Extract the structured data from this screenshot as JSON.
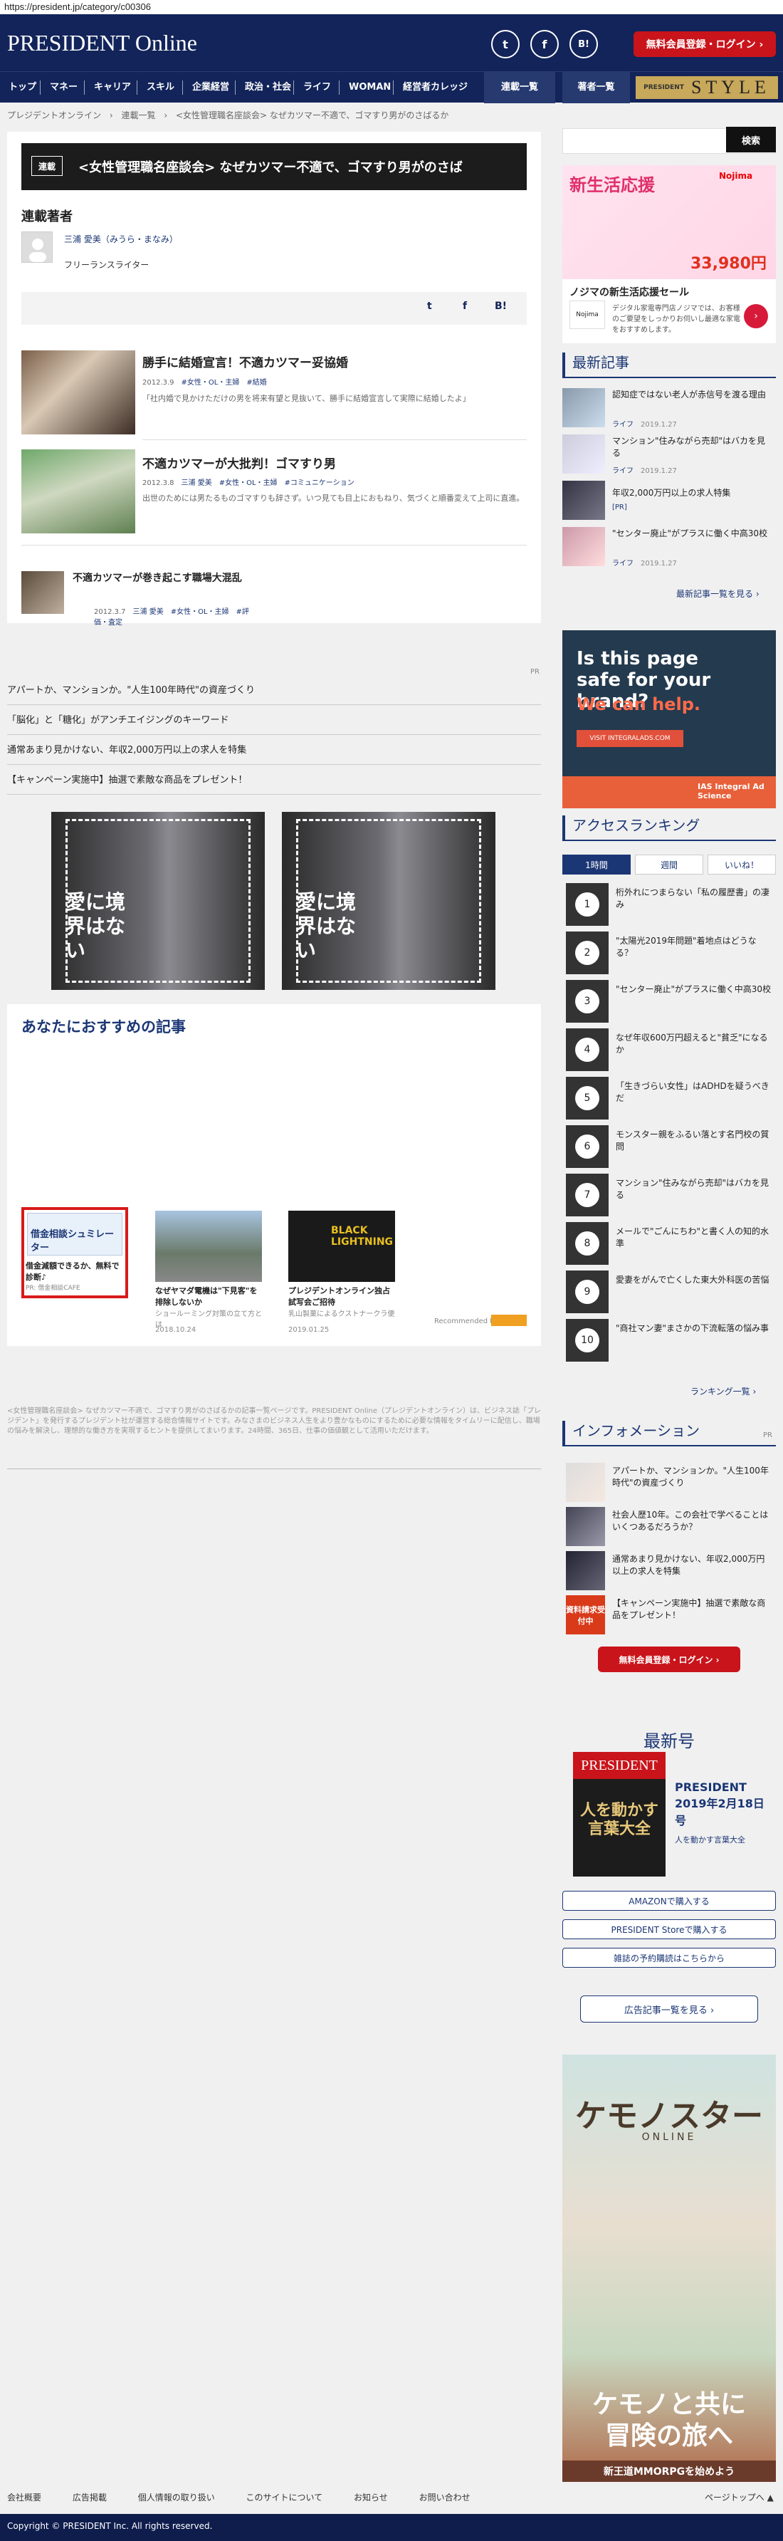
{
  "browser": {
    "url": "https://president.jp/category/c00306"
  },
  "header": {
    "logo_main": "PRESIDENT",
    "logo_sub": "Online",
    "member_button": "無料会員登録・ログイン ›",
    "sns": [
      "t",
      "f",
      "B!"
    ]
  },
  "nav": {
    "items": [
      "トップ",
      "マネー",
      "キャリア",
      "スキル",
      "企業経営",
      "政治・社会",
      "ライフ",
      "WOMAN",
      "経営者カレッジ"
    ],
    "serial_label": "連載一覧",
    "author_label": "著者一覧",
    "style_small": "PRESIDENT",
    "style_big": "STYLE"
  },
  "breadcrumb": [
    "プレジデントオンライン",
    "›",
    "連載一覧",
    "›",
    "<女性管理職名座談会> なぜカツマー不適で、ゴマすり男がのさばるか"
  ],
  "search": {
    "button": "検索",
    "placeholder": ""
  },
  "main": {
    "series_badge": "連載",
    "series_title": "<女性管理職名座談会> なぜカツマー不適で、ゴマすり男がのさば",
    "authors_heading": "連載著者",
    "author_name": "三浦 愛美（みうら・まなみ）",
    "author_role": "フリーランスライター",
    "share": [
      "t",
      "f",
      "B!"
    ],
    "articles": [
      {
        "title": "勝手に結婚宣言！不適カツマー妥協婚",
        "date": "2012.3.9",
        "tags": [
          "#女性・OL・主婦",
          "#結婚"
        ],
        "desc": "「社内婚で見かけただけの男を将来有望と見抜いて、勝手に結婚宣言して実際に結婚したよ」"
      },
      {
        "title": "不適カツマーが大批判！ゴマすり男",
        "date": "2012.3.8",
        "author": "三浦 愛美",
        "tags": [
          "#女性・OL・主婦",
          "#コミュニケーション"
        ],
        "desc": "出世のためには男たるものゴマすりも辞さず。いつ見ても目上におもねり、気づくと順番変えて上司に直進。"
      },
      {
        "title": "不適カツマーが巻き起こす職場大混乱",
        "date": "2012.3.7",
        "author": "三浦 愛美",
        "tags": [
          "#女性・OL・主婦",
          "#評価・査定"
        ]
      }
    ],
    "pr_label": "PR",
    "pr_links": [
      "アパートか、マンションか。\"人生100年時代\"の資産づくり",
      "「脳化」と「糖化」がアンチエイジングのキーワード",
      "通常あまり見かけない、年収2,000万円以上の求人を特集",
      "【キャンペーン実施中】抽選で素敵な商品をプレゼント！"
    ],
    "ad_text": "愛に境界はない",
    "recommend_heading": "あなたにおすすめの記事",
    "recommend": [
      {
        "title": "借金減額できるか、無料で診断♪",
        "meta": "PR: 借金相談CAFE",
        "img_text": "借金相談シュミレーター"
      },
      {
        "title": "なぜヤマダ電機は\"下見客\"を排除しないか",
        "meta": "ショールーミング対策の立て方とは",
        "date": "2018.10.24"
      },
      {
        "title": "プレジデントオンライン独占試写会ご招待",
        "meta": "乳山製菓によるクストナークラ便",
        "date": "2019.01.25",
        "img_text": "BLACK LIGHTNING"
      }
    ],
    "recommended_by": "Recommended by",
    "description": "<女性管理職名座談会> なぜカツマー不適で、ゴマすり男がのさばるかの記事一覧ページです。PRESIDENT Online（プレジデントオンライン）は、ビジネス誌「プレジデント」を発行するプレジデント社が運営する総合情報サイトです。みなさまのビジネス人生をより豊かなものにするために必要な情報をタイムリーに配信し、職場の悩みを解決し、理想的な働き方を実現するヒントを提供してまいります。24時間、365日、仕事の価値観として活用いただけます。"
  },
  "sidebar": {
    "ad1_title": "新生活応援",
    "ad1_sub": "ノジマの新生活応援セール",
    "ad1_desc": "デジタル家電専門店ノジマでは、お客様のご要望をしっかりお伺いし最適な家電をおすすめします。",
    "ad1_price": "33,980円",
    "ad1_brand": "Nojima",
    "latest_heading": "最新記事",
    "latest": [
      {
        "title": "認知症ではない老人が赤信号を渡る理由",
        "cat": "ライフ",
        "date": "2019.1.27"
      },
      {
        "title": "マンション\"住みながら売却\"はバカを見る",
        "cat": "ライフ",
        "date": "2019.1.27"
      },
      {
        "title": "年収2,000万円以上の求人特集",
        "cat": "[PR]",
        "date": ""
      },
      {
        "title": "\"センター廃止\"がプラスに働く中高30校",
        "cat": "ライフ",
        "date": "2019.1.27"
      }
    ],
    "latest_more": "最新記事一覧を見る ›",
    "ias_q": "Is this page safe for your brand?",
    "ias_a": "We can help.",
    "ias_btn": "VISIT INTEGRALADS.COM",
    "ias_logo": "IAS Integral Ad Science",
    "ranking_heading": "アクセスランキング",
    "ranking_tabs": [
      "1時間",
      "週間",
      "いいね！"
    ],
    "ranking": [
      "桁外れにつまらない「私の履歴書」の凄み",
      "\"太陽光2019年問題\"着地点はどうなる？",
      "\"センター廃止\"がプラスに働く中高30校",
      "なぜ年収600万円超えると\"貧乏\"になるか",
      "「生きづらい女性」はADHDを疑うべきだ",
      "モンスター親をふるい落とす名門校の質問",
      "マンション\"住みながら売却\"はバカを見る",
      "メールで\"ごんにちわ\"と書く人の知的水準",
      "愛妻をがんで亡くした東大外科医の苦悩",
      "\"商社マン妻\"まさかの下流転落の悩み事"
    ],
    "ranking_more": "ランキング一覧 ›",
    "info_heading": "インフォメーション",
    "info_pr": "PR",
    "info": [
      "アパートか、マンションか。\"人生100年時代\"の資産づくり",
      "社会人歴10年。この会社で学べることはいくつあるだろうか？",
      "通常あまり見かけない、年収2,000万円以上の求人を特集",
      "【キャンペーン実施中】抽選で素敵な商品をプレゼント！"
    ],
    "info_badge": "資料請求受付中",
    "member_button": "無料会員登録・ログイン ›",
    "latest_issue_heading": "最新号",
    "issue_logo": "PRESIDENT",
    "issue_cover_text": "人を動かす言葉大全",
    "issue_title": "PRESIDENT 2019年2月18日号",
    "issue_sub": "人を動かす言葉大全",
    "buy_links": [
      "AMAZONで購入する",
      "PRESIDENT Storeで購入する",
      "雑誌の予約購読はこちらから"
    ],
    "ad_list_button": "広告記事一覧を見る ›",
    "game_title": "ケモノスター",
    "game_sub": "ONLINE",
    "game_catch": "ケモノと共に冒険の旅へ",
    "game_footer": "新王道MMORPGを始めよう"
  },
  "footer": {
    "links": [
      "会社概要",
      "広告掲載",
      "個人情報の取り扱い",
      "このサイトについて",
      "お知らせ",
      "お問い合わせ"
    ],
    "pagetop": "ページトップへ ▲",
    "copyright": "Copyright © PRESIDENT Inc. All rights reserved."
  }
}
